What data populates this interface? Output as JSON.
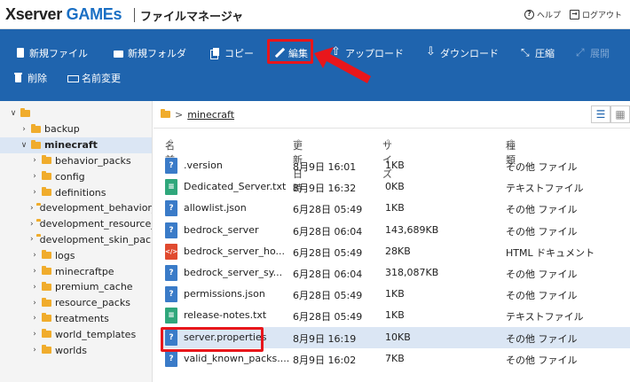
{
  "header": {
    "logo_main": "Xserver ",
    "logo_accent": "GAMEs",
    "app_title": "ファイルマネージャ",
    "help_label": "ヘルプ",
    "logout_label": "ログアウト"
  },
  "toolbar": {
    "new_file": "新規ファイル",
    "new_folder": "新規フォルダ",
    "copy": "コピー",
    "edit": "編集",
    "upload": "アップロード",
    "download": "ダウンロード",
    "compress": "圧縮",
    "extract": "展開",
    "delete": "削除",
    "rename": "名前変更"
  },
  "sidebar": {
    "items": [
      {
        "label": "",
        "level": 0,
        "chev": "∨"
      },
      {
        "label": "backup",
        "level": 1,
        "chev": "›"
      },
      {
        "label": "minecraft",
        "level": 1,
        "chev": "∨"
      },
      {
        "label": "behavior_packs",
        "level": 2,
        "chev": "›"
      },
      {
        "label": "config",
        "level": 2,
        "chev": "›"
      },
      {
        "label": "definitions",
        "level": 2,
        "chev": "›"
      },
      {
        "label": "development_behavior_packs",
        "level": 2,
        "chev": "›"
      },
      {
        "label": "development_resource_packs",
        "level": 2,
        "chev": "›"
      },
      {
        "label": "development_skin_packs",
        "level": 2,
        "chev": "›"
      },
      {
        "label": "logs",
        "level": 2,
        "chev": "›"
      },
      {
        "label": "minecraftpe",
        "level": 2,
        "chev": "›"
      },
      {
        "label": "premium_cache",
        "level": 2,
        "chev": "›"
      },
      {
        "label": "resource_packs",
        "level": 2,
        "chev": "›"
      },
      {
        "label": "treatments",
        "level": 2,
        "chev": "›"
      },
      {
        "label": "world_templates",
        "level": 2,
        "chev": "›"
      },
      {
        "label": "worlds",
        "level": 2,
        "chev": "›"
      }
    ],
    "selected": "minecraft"
  },
  "breadcrumb": {
    "separator": ">",
    "current": "minecraft"
  },
  "table": {
    "headers": {
      "name": "名前",
      "modified": "更新日時",
      "size": "サイズ",
      "type": "種類"
    },
    "sort_icon": "⇕",
    "rows": [
      {
        "icon": "unknown",
        "icon_glyph": "?",
        "name": ".version",
        "modified": "8月9日 16:01",
        "size": "1KB",
        "type": "その他 ファイル"
      },
      {
        "icon": "text",
        "icon_glyph": "≡",
        "name": "Dedicated_Server.txt",
        "modified": "8月9日 16:32",
        "size": "0KB",
        "type": "テキストファイル"
      },
      {
        "icon": "unknown",
        "icon_glyph": "?",
        "name": "allowlist.json",
        "modified": "6月28日 05:49",
        "size": "1KB",
        "type": "その他 ファイル"
      },
      {
        "icon": "unknown",
        "icon_glyph": "?",
        "name": "bedrock_server",
        "modified": "6月28日 06:04",
        "size": "143,689KB",
        "type": "その他 ファイル"
      },
      {
        "icon": "html",
        "icon_glyph": "</>",
        "name": "bedrock_server_ho...",
        "modified": "6月28日 05:49",
        "size": "28KB",
        "type": "HTML ドキュメント"
      },
      {
        "icon": "unknown",
        "icon_glyph": "?",
        "name": "bedrock_server_sy...",
        "modified": "6月28日 06:04",
        "size": "318,087KB",
        "type": "その他 ファイル"
      },
      {
        "icon": "unknown",
        "icon_glyph": "?",
        "name": "permissions.json",
        "modified": "6月28日 05:49",
        "size": "1KB",
        "type": "その他 ファイル"
      },
      {
        "icon": "text",
        "icon_glyph": "≡",
        "name": "release-notes.txt",
        "modified": "6月28日 05:49",
        "size": "1KB",
        "type": "テキストファイル"
      },
      {
        "icon": "unknown",
        "icon_glyph": "?",
        "name": "server.properties",
        "modified": "8月9日 16:19",
        "size": "10KB",
        "type": "その他 ファイル"
      },
      {
        "icon": "unknown",
        "icon_glyph": "?",
        "name": "valid_known_packs....",
        "modified": "8月9日 16:02",
        "size": "7KB",
        "type": "その他 ファイル"
      }
    ],
    "selected_row": "server.properties"
  },
  "colors": {
    "toolbar_bg": "#1f64ae",
    "highlight": "#e8161b",
    "selection": "#dbe6f4",
    "folder": "#f0ac2c"
  }
}
